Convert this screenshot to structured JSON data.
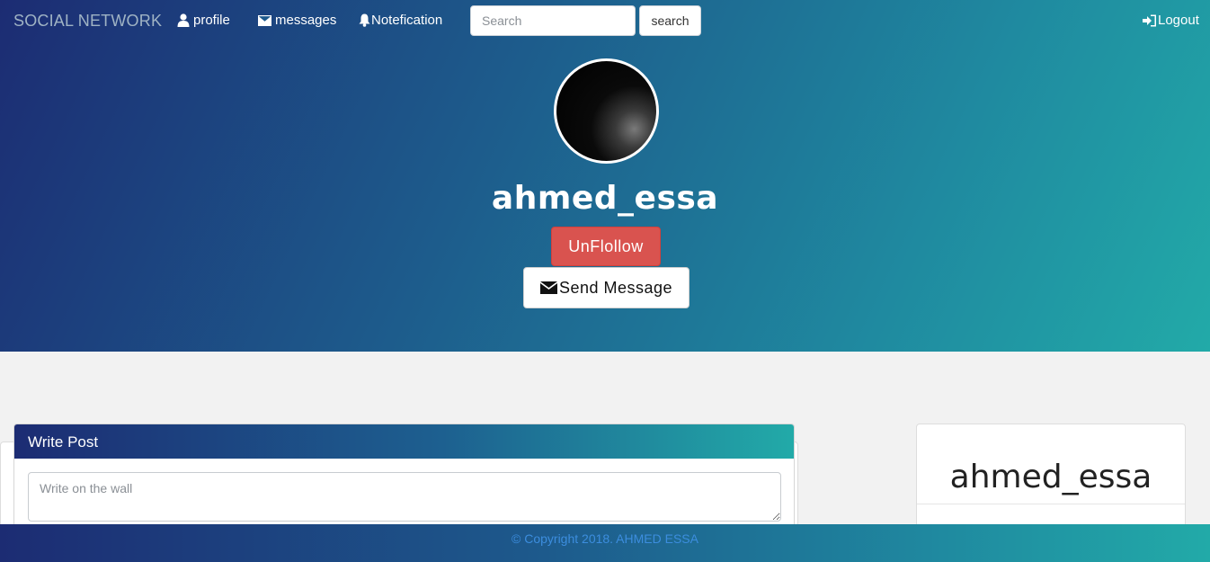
{
  "navbar": {
    "brand": "SOCIAL NETWORK",
    "links": {
      "profile": "profile",
      "messages": "messages",
      "notification": "Notefication",
      "logout": "Logout"
    },
    "search": {
      "placeholder": "Search",
      "button": "search"
    }
  },
  "profile": {
    "username": "ahmed_essa",
    "unfollow_label": "UnFlollow",
    "message_label": "Send Message"
  },
  "post": {
    "header": "Write Post",
    "placeholder": "Write on the wall"
  },
  "side": {
    "username": "ahmed_essa"
  },
  "footer": {
    "copyright": "© Copyright 2018. AHMED ESSA"
  },
  "colors": {
    "gradient_start": "#1c2c73",
    "gradient_end": "#22aaa8",
    "unfollow": "#d9534f",
    "footer_text": "#3c8dde"
  },
  "icons": {
    "profile": "user-icon",
    "messages": "envelope-icon",
    "notification": "bell-icon",
    "logout": "login-arrow-icon",
    "send_message": "envelope-icon"
  }
}
